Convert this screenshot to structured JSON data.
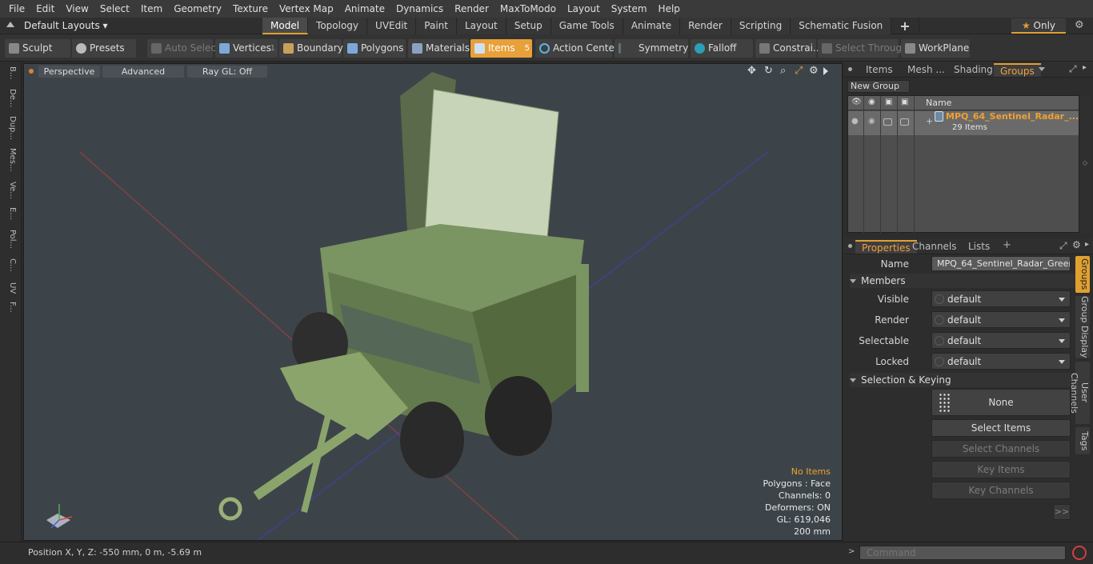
{
  "menu": [
    "File",
    "Edit",
    "View",
    "Select",
    "Item",
    "Geometry",
    "Texture",
    "Vertex Map",
    "Animate",
    "Dynamics",
    "Render",
    "MaxToModo",
    "Layout",
    "System",
    "Help"
  ],
  "layouts_label": "Default Layouts",
  "tabs": [
    "Model",
    "Topology",
    "UVEdit",
    "Paint",
    "Layout",
    "Setup",
    "Game Tools",
    "Animate",
    "Render",
    "Scripting",
    "Schematic Fusion"
  ],
  "tabs_plus": "+",
  "only_label": "Only",
  "toolbar": {
    "sculpt": "Sculpt",
    "presets": "Presets",
    "auto_select": "Auto Select",
    "vertices": "Vertices",
    "vertices_count": "1",
    "boundary": "Boundary",
    "polygons": "Polygons",
    "materials": "Materials",
    "items": "Items",
    "items_count": "5",
    "action_center": "Action Center",
    "symmetry": "Symmetry",
    "falloff": "Falloff",
    "constraints": "Constrai...",
    "select_through": "Select Through",
    "workplane": "WorkPlane"
  },
  "left_tabs": [
    "B...",
    "De...",
    "Dup...",
    "Mes...",
    "Ve...",
    "E...",
    "Pol...",
    "C...",
    "UV",
    "F..."
  ],
  "viewport": {
    "perspective": "Perspective",
    "advanced": "Advanced",
    "raygl": "Ray GL: Off",
    "hud": [
      "No Items",
      "Polygons : Face",
      "Channels: 0",
      "Deformers: ON",
      "GL: 619,046",
      "200 mm"
    ]
  },
  "status": {
    "position": "Position X, Y, Z:   -550 mm, 0 m, -5.69 m"
  },
  "top_panel": {
    "tabs": [
      "Items",
      "Mesh ...",
      "Shading",
      "Groups"
    ],
    "new_group": "New Group",
    "name_header": "Name",
    "group_name": "MPQ_64_Sentinel_Radar_...",
    "group_count": "29 Items"
  },
  "props": {
    "tabs": [
      "Properties",
      "Channels",
      "Lists"
    ],
    "name_label": "Name",
    "name_value": "MPQ_64_Sentinel_Radar_Green_",
    "members": "Members",
    "visible_label": "Visible",
    "render_label": "Render",
    "selectable_label": "Selectable",
    "locked_label": "Locked",
    "default_value": "default",
    "sel_keying": "Selection & Keying",
    "none": "None",
    "select_items": "Select Items",
    "select_channels": "Select Channels",
    "key_items": "Key Items",
    "key_channels": "Key Channels",
    "more": ">>"
  },
  "right_vtabs": [
    "Groups",
    "Group Display",
    "User Channels",
    "Tags"
  ],
  "command_placeholder": "Command",
  "colors": {
    "accent": "#e0a030",
    "group_name": "#f0a030"
  }
}
